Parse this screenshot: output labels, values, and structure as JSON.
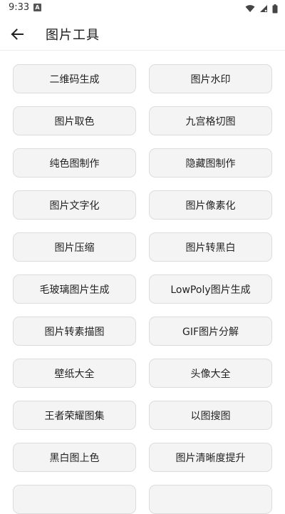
{
  "status_bar": {
    "time": "9:33",
    "notification_badge": "A",
    "icons": [
      "wifi-icon",
      "signal-icon",
      "battery-icon"
    ]
  },
  "app_bar": {
    "title": "图片工具",
    "back_icon": "arrow-left-icon"
  },
  "tools": [
    {
      "label": "二维码生成",
      "name": "tool-qr-code-generate"
    },
    {
      "label": "图片水印",
      "name": "tool-image-watermark"
    },
    {
      "label": "图片取色",
      "name": "tool-color-picker"
    },
    {
      "label": "九宫格切图",
      "name": "tool-nine-grid-cut"
    },
    {
      "label": "纯色图制作",
      "name": "tool-solid-color-image"
    },
    {
      "label": "隐藏图制作",
      "name": "tool-hidden-image"
    },
    {
      "label": "图片文字化",
      "name": "tool-image-to-text"
    },
    {
      "label": "图片像素化",
      "name": "tool-pixelate"
    },
    {
      "label": "图片压缩",
      "name": "tool-compress"
    },
    {
      "label": "图片转黑白",
      "name": "tool-black-white"
    },
    {
      "label": "毛玻璃图片生成",
      "name": "tool-frosted-glass"
    },
    {
      "label": "LowPoly图片生成",
      "name": "tool-lowpoly"
    },
    {
      "label": "图片转素描图",
      "name": "tool-sketch"
    },
    {
      "label": "GIF图片分解",
      "name": "tool-gif-split"
    },
    {
      "label": "壁纸大全",
      "name": "tool-wallpapers"
    },
    {
      "label": "头像大全",
      "name": "tool-avatars"
    },
    {
      "label": "王者荣耀图集",
      "name": "tool-honor-of-kings-gallery"
    },
    {
      "label": "以图搜图",
      "name": "tool-reverse-image-search"
    },
    {
      "label": "黑白图上色",
      "name": "tool-colorize"
    },
    {
      "label": "图片清晰度提升",
      "name": "tool-enhance-clarity"
    },
    {
      "label": "",
      "name": "tool-partial-left"
    },
    {
      "label": "",
      "name": "tool-partial-right"
    }
  ],
  "colors": {
    "button_bg": "#f4f4f4",
    "button_border": "#dcdcdc",
    "text": "#222222"
  }
}
